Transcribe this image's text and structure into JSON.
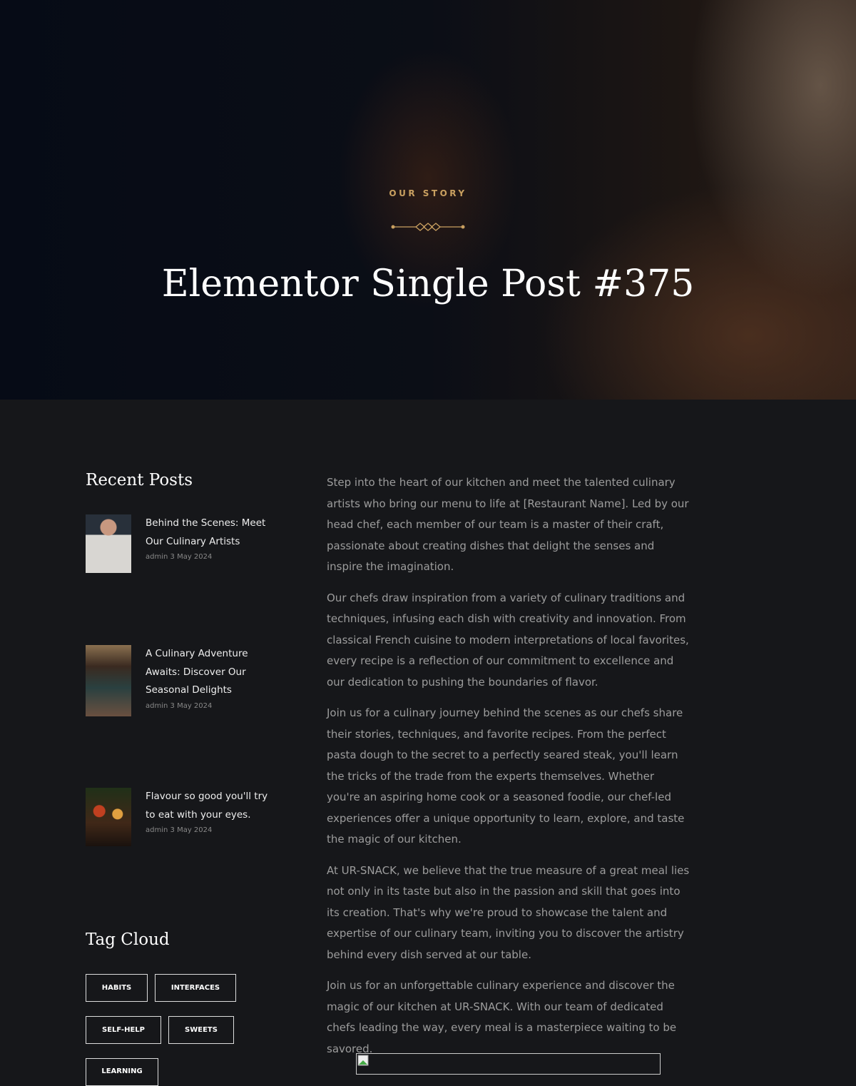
{
  "hero": {
    "eyebrow": "OUR STORY",
    "title": "Elementor Single Post #375",
    "accent": "#c9a060"
  },
  "sidebar": {
    "recent_title": "Recent Posts",
    "posts": [
      {
        "title": "Behind the Scenes: Meet Our Culinary Artists",
        "author": "admin",
        "date": "3 May 2024",
        "image": "chef-portrait"
      },
      {
        "title": "A Culinary Adventure Awaits: Discover Our Seasonal Delights",
        "author": "admin",
        "date": "3 May 2024",
        "image": "restaurant-interior"
      },
      {
        "title": "Flavour so good you'll try to eat with your eyes.",
        "author": "admin",
        "date": "3 May 2024",
        "image": "food-table"
      }
    ],
    "tag_title": "Tag Cloud",
    "tags": [
      "HABITS",
      "INTERFACES",
      "SELF-HELP",
      "SWEETS",
      "LEARNING"
    ]
  },
  "content": {
    "paragraphs": [
      "Step into the heart of our kitchen and meet the talented culinary artists who bring our menu to life at [Restaurant Name]. Led by our head chef, each member of our team is a master of their craft, passionate about creating dishes that delight the senses and inspire the imagination.",
      "Our chefs draw inspiration from a variety of culinary traditions and techniques, infusing each dish with creativity and innovation. From classical French cuisine to modern interpretations of local favorites, every recipe is a reflection of our commitment to excellence and our dedication to pushing the boundaries of flavor.",
      "Join us for a culinary journey behind the scenes as our chefs share their stories, techniques, and favorite recipes. From the perfect pasta dough to the secret to a perfectly seared steak, you'll learn the tricks of the trade from the experts themselves. Whether you're an aspiring home cook or a seasoned foodie, our chef-led experiences offer a unique opportunity to learn, explore, and taste the magic of our kitchen.",
      "At UR-SNACK, we believe that the true measure of a great meal lies not only in its taste but also in the passion and skill that goes into its creation. That's why we're proud to showcase the talent and expertise of our culinary team, inviting you to discover the artistry behind every dish served at our table.",
      "Join us for an unforgettable culinary experience and discover the magic of our kitchen at UR-SNACK. With our team of dedicated chefs leading the way, every meal is a masterpiece waiting to be savored."
    ]
  }
}
